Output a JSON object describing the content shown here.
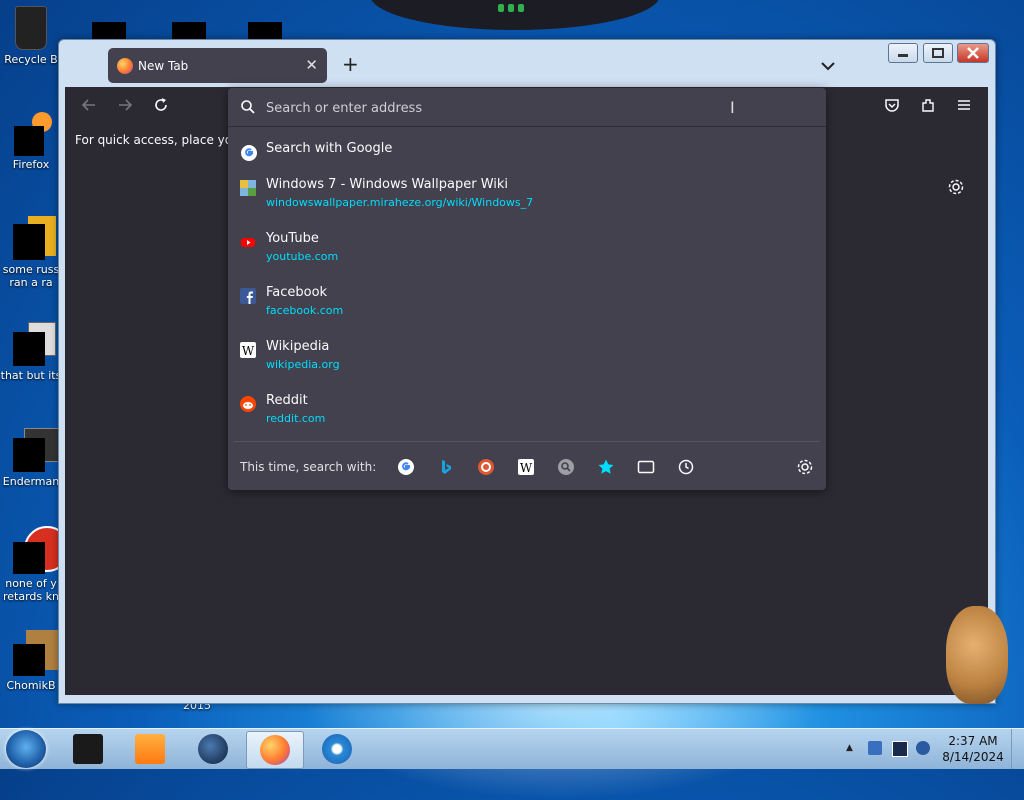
{
  "desktop": {
    "icons": [
      {
        "label": "Recycle B"
      },
      {
        "label": "Firefox"
      },
      {
        "label": "some russ",
        "label2": "ran a ra"
      },
      {
        "label": "that but its"
      },
      {
        "label": "Enderman"
      },
      {
        "label": "none of y",
        "label2": "retards kn"
      },
      {
        "label": "ChomikB"
      }
    ],
    "year_label": "2015"
  },
  "browser": {
    "tab_title": "New Tab",
    "bookmarks_hint": "For quick access, place your b",
    "urlbar": {
      "placeholder": "Search or enter address",
      "value": ""
    },
    "suggestions": [
      {
        "title": "Search with Google",
        "url": ""
      },
      {
        "title": "Windows 7 - Windows Wallpaper Wiki",
        "url": "windowswallpaper.miraheze.org/wiki/Windows_7"
      },
      {
        "title": "YouTube",
        "url": "youtube.com"
      },
      {
        "title": "Facebook",
        "url": "facebook.com"
      },
      {
        "title": "Wikipedia",
        "url": "wikipedia.org"
      },
      {
        "title": "Reddit",
        "url": "reddit.com"
      }
    ],
    "one_off_label": "This time, search with:",
    "one_off_engines": [
      "google-icon",
      "bing-icon",
      "duckduckgo-icon",
      "wikipedia-icon",
      "search-engine-icon",
      "bookmarks-icon",
      "tabs-icon",
      "history-icon"
    ]
  },
  "taskbar": {
    "time": "2:37 AM",
    "date": "8/14/2024"
  },
  "colors": {
    "panel_bg": "#42414d",
    "browser_bg": "#2b2a33",
    "url_color": "#00ddff",
    "text": "#fbfbfe"
  }
}
